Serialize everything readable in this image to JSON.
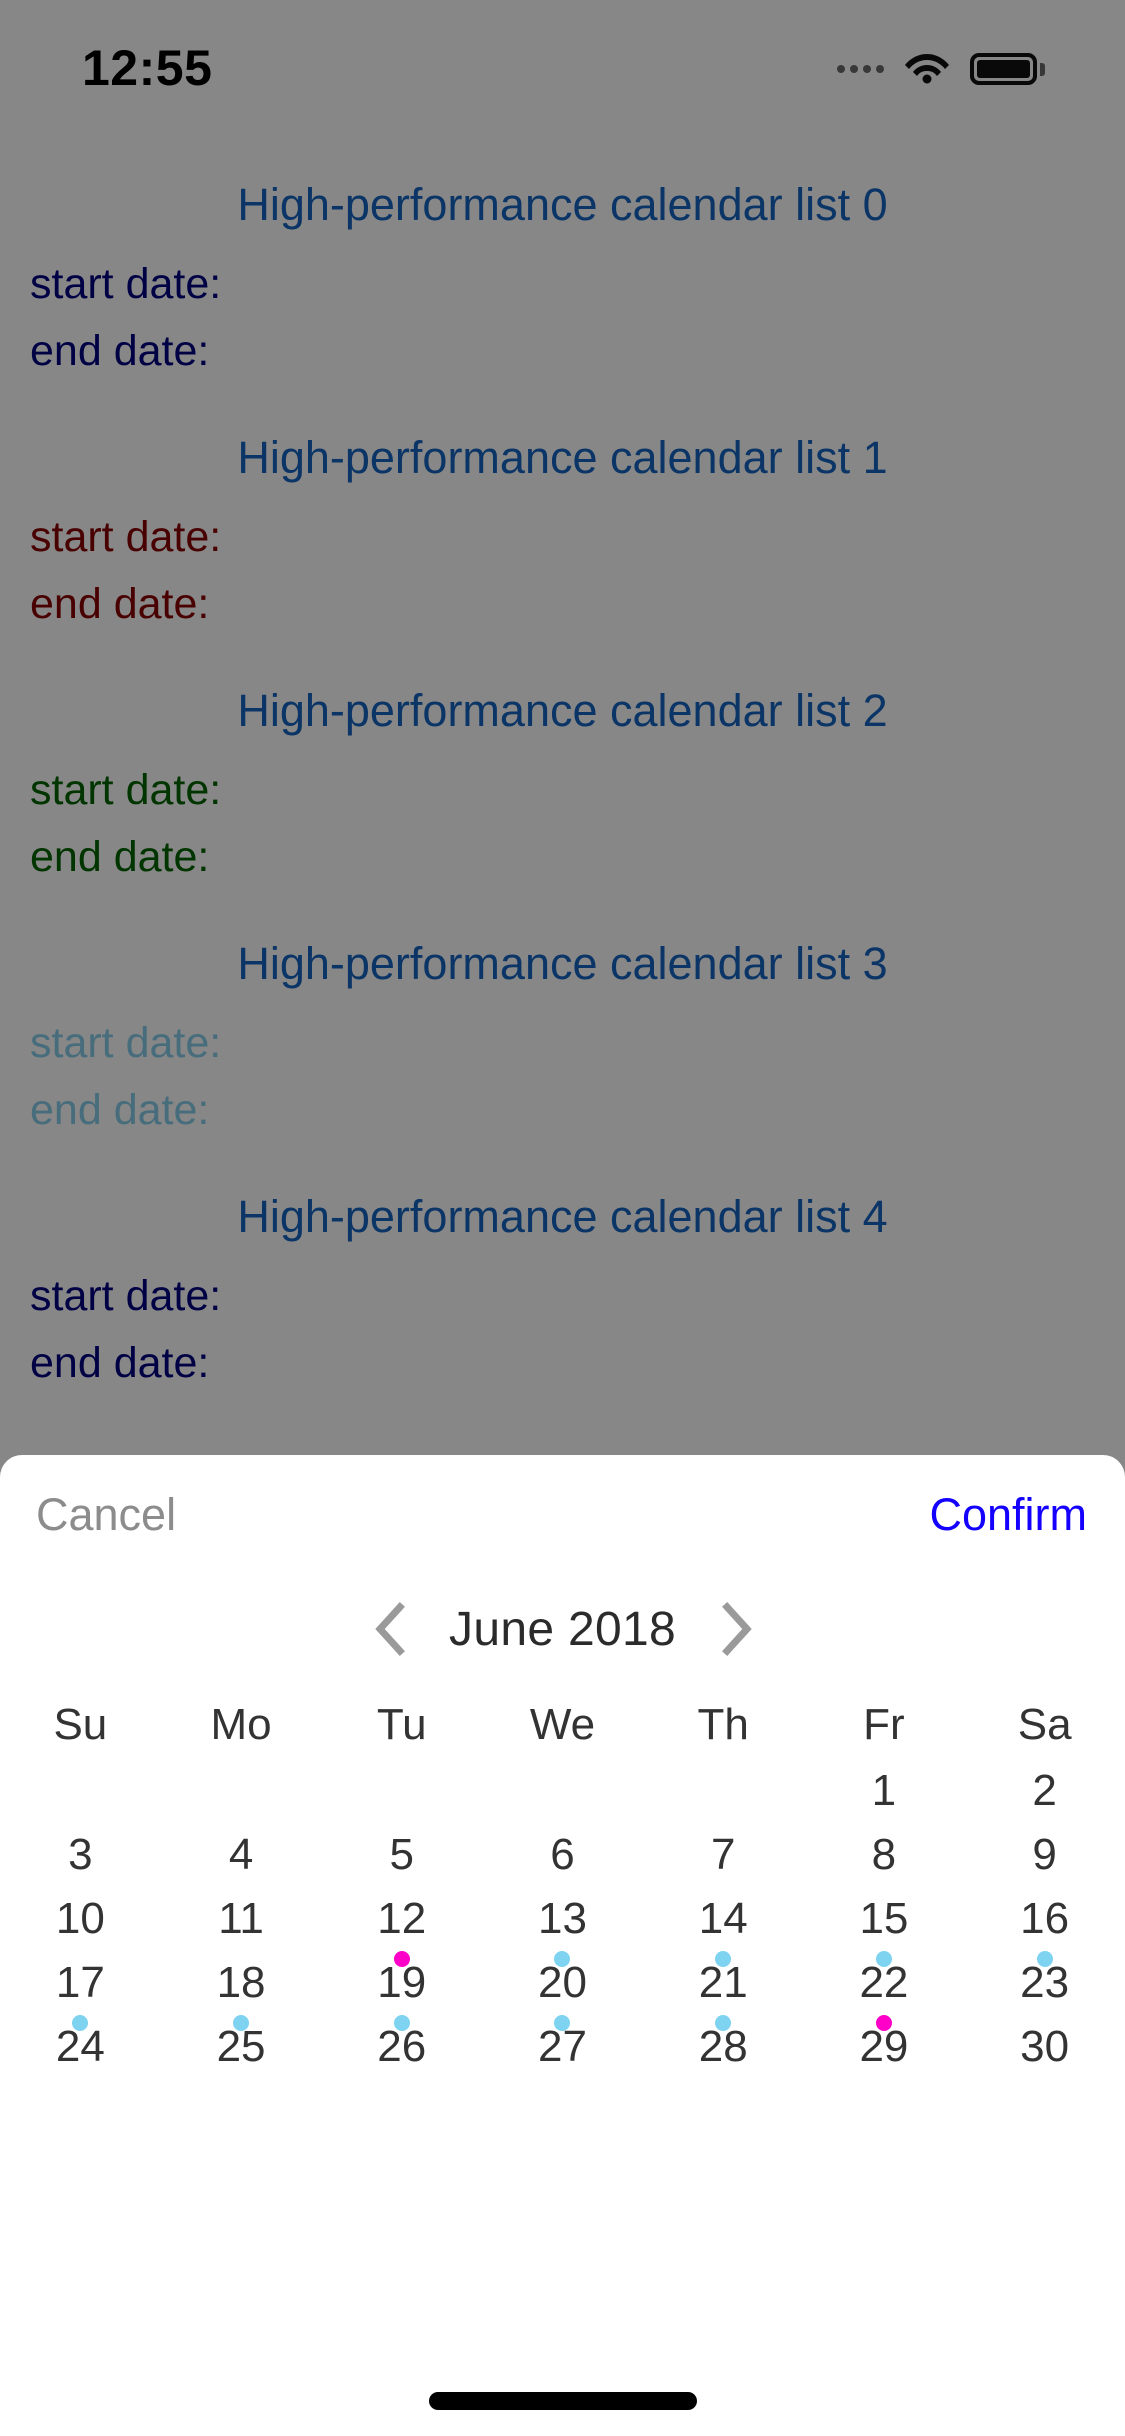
{
  "status_bar": {
    "time": "12:55",
    "signal_icon": "signal-dots-icon",
    "wifi_icon": "wifi-icon",
    "battery_icon": "battery-icon"
  },
  "list": {
    "items": [
      {
        "title": "High-performance calendar list 0",
        "start_label": "start date:",
        "end_label": "end date:",
        "color": "#000080"
      },
      {
        "title": "High-performance calendar list 1",
        "start_label": "start date:",
        "end_label": "end date:",
        "color": "#8b0000"
      },
      {
        "title": "High-performance calendar list 2",
        "start_label": "start date:",
        "end_label": "end date:",
        "color": "#006400"
      },
      {
        "title": "High-performance calendar list 3",
        "start_label": "start date:",
        "end_label": "end date:",
        "color": "#87ceeb"
      },
      {
        "title": "High-performance calendar list 4",
        "start_label": "start date:",
        "end_label": "end date:",
        "color": "#000080"
      }
    ],
    "title_color": "#1565c0"
  },
  "sheet": {
    "cancel_label": "Cancel",
    "confirm_label": "Confirm",
    "cancel_color": "#8c8c8c",
    "confirm_color": "#1400ff",
    "prev_icon": "chevron-left-icon",
    "next_icon": "chevron-right-icon",
    "month_label": "June 2018",
    "weekdays": [
      "Su",
      "Mo",
      "Tu",
      "We",
      "Th",
      "Fr",
      "Sa"
    ],
    "leading_blanks": 5,
    "days": [
      {
        "n": "1",
        "dot": null
      },
      {
        "n": "2",
        "dot": null
      },
      {
        "n": "3",
        "dot": null
      },
      {
        "n": "4",
        "dot": null
      },
      {
        "n": "5",
        "dot": null
      },
      {
        "n": "6",
        "dot": null
      },
      {
        "n": "7",
        "dot": null
      },
      {
        "n": "8",
        "dot": null
      },
      {
        "n": "9",
        "dot": null
      },
      {
        "n": "10",
        "dot": null
      },
      {
        "n": "11",
        "dot": null
      },
      {
        "n": "12",
        "dot": "pink"
      },
      {
        "n": "13",
        "dot": "blue"
      },
      {
        "n": "14",
        "dot": "blue"
      },
      {
        "n": "15",
        "dot": "blue"
      },
      {
        "n": "16",
        "dot": "blue"
      },
      {
        "n": "17",
        "dot": "blue"
      },
      {
        "n": "18",
        "dot": "blue"
      },
      {
        "n": "19",
        "dot": "blue"
      },
      {
        "n": "20",
        "dot": "blue"
      },
      {
        "n": "21",
        "dot": "blue"
      },
      {
        "n": "22",
        "dot": "pink"
      },
      {
        "n": "23",
        "dot": null
      },
      {
        "n": "24",
        "dot": null
      },
      {
        "n": "25",
        "dot": null
      },
      {
        "n": "26",
        "dot": null
      },
      {
        "n": "27",
        "dot": null
      },
      {
        "n": "28",
        "dot": null
      },
      {
        "n": "29",
        "dot": null
      },
      {
        "n": "30",
        "dot": null
      }
    ],
    "dot_colors": {
      "blue": "#7dd3f0",
      "pink": "#ff00c8"
    }
  },
  "home_indicator": "home-indicator"
}
